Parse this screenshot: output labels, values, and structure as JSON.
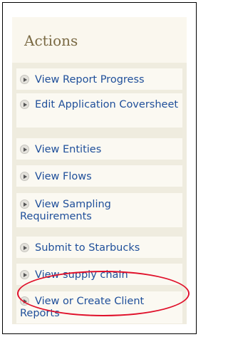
{
  "panel": {
    "title": "Actions",
    "items": [
      {
        "label": "View Report Progress"
      },
      {
        "label": "Edit Application Coversheet"
      },
      {
        "label": "View Entities"
      },
      {
        "label": "View Flows"
      },
      {
        "label": "View Sampling Requirements"
      },
      {
        "label": "Submit to Starbucks"
      },
      {
        "label": "View supply chain"
      },
      {
        "label": "View or Create Client Reports"
      }
    ]
  },
  "colors": {
    "link": "#1f4f9a",
    "title": "#7a6a44",
    "panel_bg": "#efecdf",
    "item_bg": "#fbf9f2",
    "highlight": "#e0102a"
  },
  "icons": {
    "bullet": "play-circle-icon"
  }
}
